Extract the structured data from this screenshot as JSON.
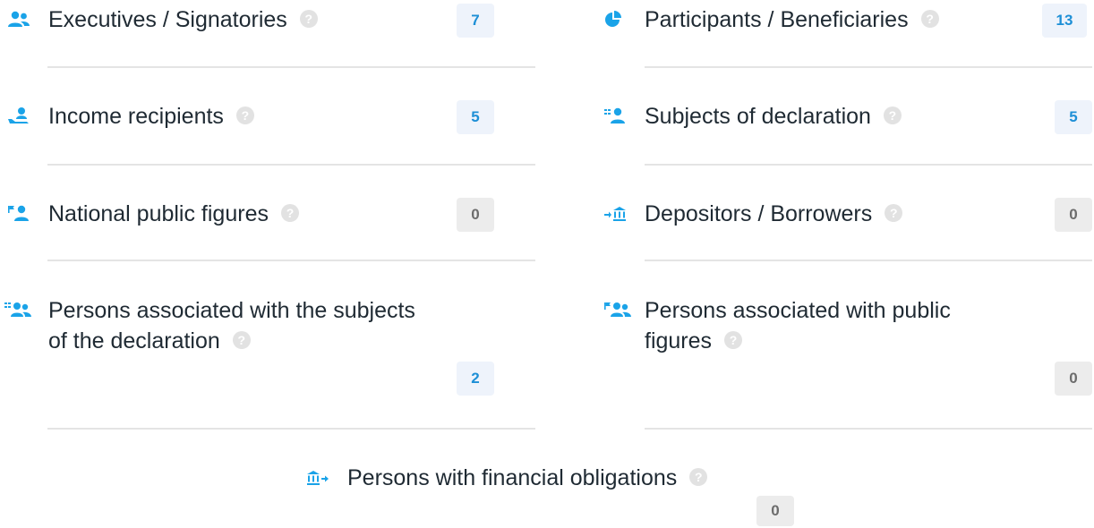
{
  "left": [
    {
      "icon": "users-icon",
      "label": "Executives / Signatories",
      "count": "7"
    },
    {
      "icon": "hand-user-icon",
      "label": "Income recipients",
      "count": "5"
    },
    {
      "icon": "flag-user-icon",
      "label": "National public figures",
      "count": "0"
    },
    {
      "icon": "list-users-icon",
      "label_line1": "Persons associated with the subjects",
      "label_line2": "of the declaration",
      "count": "2"
    }
  ],
  "right": [
    {
      "icon": "pie-chart-icon",
      "label": "Participants / Beneficiaries",
      "count": "13"
    },
    {
      "icon": "list-user-icon",
      "label": "Subjects of declaration",
      "count": "5"
    },
    {
      "icon": "arrow-bank-icon",
      "label": "Depositors / Borrowers",
      "count": "0"
    },
    {
      "icon": "flag-users-icon",
      "label_line1": "Persons associated with public",
      "label_line2": "figures",
      "count": "0"
    }
  ],
  "bottom": {
    "icon": "bank-arrow-icon",
    "label": "Persons with financial obligations",
    "count": "0"
  },
  "colors": {
    "accent": "#1d8fd6",
    "icon": "#1aa3e8",
    "badge_active_bg": "#eef3fb",
    "badge_zero_bg": "#ececec"
  }
}
